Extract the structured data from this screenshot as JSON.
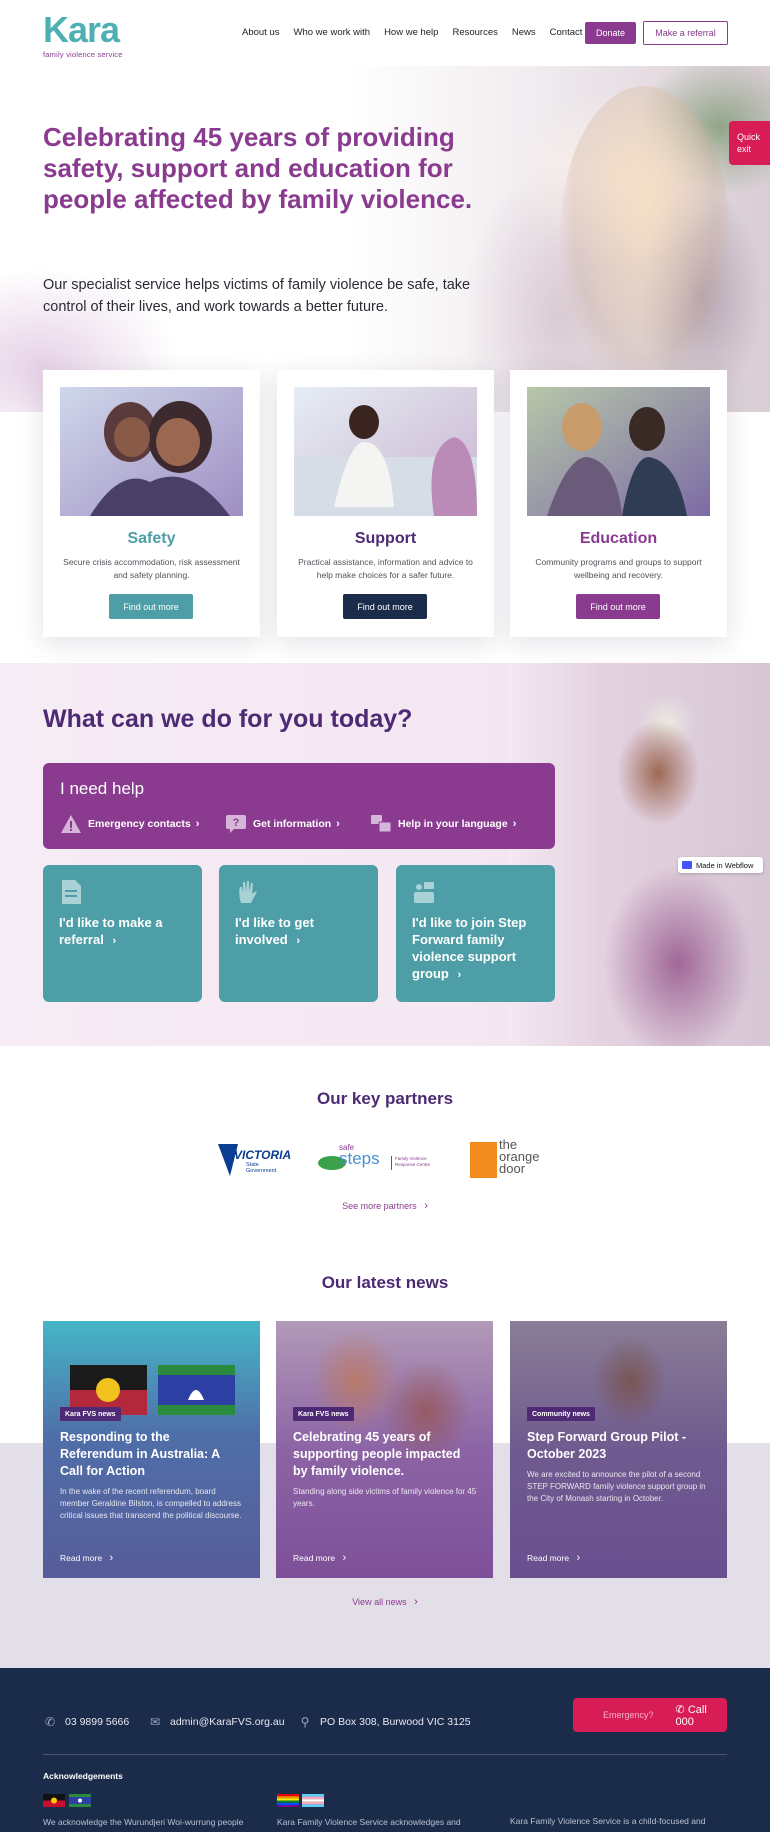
{
  "header": {
    "logo_word": "Kara",
    "logo_tagline": "family violence service",
    "nav": [
      "About us",
      "Who we work with",
      "How we help",
      "Resources",
      "News",
      "Contact"
    ],
    "donate_label": "Donate",
    "referral_label": "Make a referral"
  },
  "hero": {
    "title": "Celebrating 45 years of providing safety, support and education for people affected by family violence.",
    "subtitle": "Our specialist service helps victims of family violence be safe, take control of their lives, and work towards a better future.",
    "quick_exit_1": "Quick",
    "quick_exit_2": "exit"
  },
  "pillars": [
    {
      "title": "Safety",
      "text": "Secure crisis accommodation, risk assessment and safety planning.",
      "button": "Find out more",
      "color": "#4d9ea6"
    },
    {
      "title": "Support",
      "text": "Practical assistance, information and advice to help make choices for a safer future.",
      "button": "Find out more",
      "color": "#1b2b4a"
    },
    {
      "title": "Education",
      "text": "Community programs and groups to support wellbeing and recovery.",
      "button": "Find out more",
      "color": "#8a3b8f"
    }
  ],
  "help": {
    "title": "What can we do for you today?",
    "box_title": "I need help",
    "links": [
      {
        "label": "Emergency contacts",
        "icon": "warning-icon"
      },
      {
        "label": "Get information",
        "icon": "question-bubble-icon"
      },
      {
        "label": "Help in your language",
        "icon": "translate-icon"
      }
    ],
    "cards": [
      {
        "label": "I'd like to make a referral",
        "icon": "document-icon"
      },
      {
        "label": "I'd like to get involved",
        "icon": "raised-hand-icon"
      },
      {
        "label": "I'd like to join Step Forward family violence support group",
        "icon": "group-icon"
      }
    ],
    "webflow_badge": "Made in Webflow"
  },
  "partners": {
    "title": "Our key partners",
    "victoria_line1": "VICTORIA",
    "victoria_line2": "State",
    "victoria_line3": "Government",
    "safesteps_small": "safe",
    "safesteps_big": "steps",
    "safesteps_sub1": "Family Violence",
    "safesteps_sub2": "Response Centre",
    "orange_door_1": "the",
    "orange_door_2": "orange",
    "orange_door_3": "door",
    "see_more": "See more partners"
  },
  "news": {
    "title": "Our latest news",
    "items": [
      {
        "tag": "Kara FVS news",
        "headline": "Responding to the Referendum in Australia: A Call for Action",
        "body": "In the wake of the recent referendum, board member Geraldine Bilston, is compelled to address critical issues that transcend the political discourse.",
        "read": "Read more"
      },
      {
        "tag": "Kara FVS news",
        "headline": "Celebrating 45 years of supporting people impacted by family violence.",
        "body": "Standing along side victims of family violence for 45 years.",
        "read": "Read more"
      },
      {
        "tag": "Community news",
        "headline": "Step Forward Group Pilot - October 2023",
        "body": "We are excited to announce the pilot of a second STEP FORWARD family violence support group in the City of Monash starting in October.",
        "read": "Read more"
      }
    ],
    "view_all": "View all news"
  },
  "footer": {
    "phone": "03 9899 5666",
    "email": "admin@KaraFVS.org.au",
    "address": "PO Box 308, Burwood VIC 3125",
    "emergency_q": "Emergency?",
    "call": "Call 000",
    "ack_heading": "Acknowledgements",
    "ack_1": "We acknowledge the Wurundjeri Woi-wurrung people",
    "ack_2": "Kara Family Violence Service acknowledges and",
    "ack_3": "Kara Family Violence Service is a child-focused and"
  },
  "colors": {
    "purple": "#8a3b8f",
    "teal": "#4d9ea6",
    "navy": "#1b2b4a",
    "dark_purple": "#4d2a73",
    "emergency_red": "#d81c55"
  }
}
